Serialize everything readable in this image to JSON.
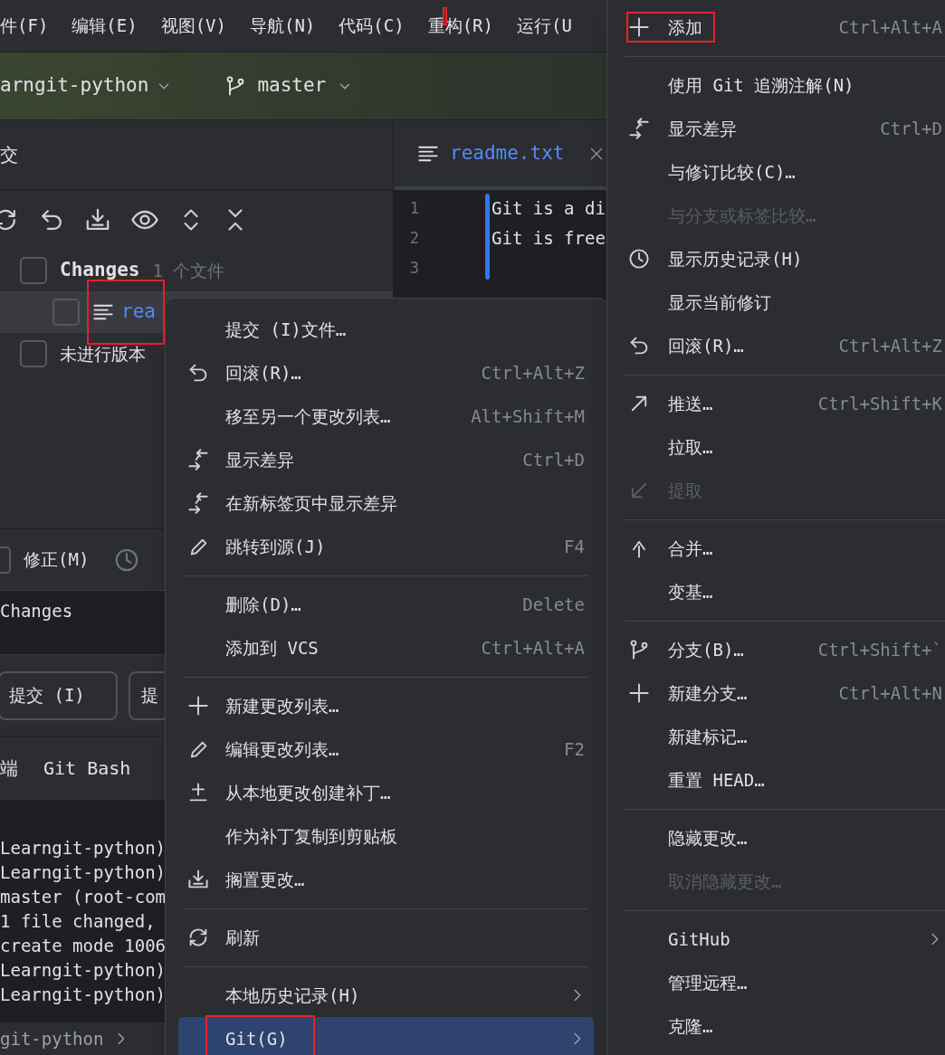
{
  "menu_bar": [
    {
      "label": "件(F)",
      "annotated": false
    },
    {
      "label": "编辑(E)",
      "annotated": false
    },
    {
      "label": "视图(V)",
      "annotated": false
    },
    {
      "label": "导航(N)",
      "annotated": false
    },
    {
      "label": "代码(C)",
      "annotated": false
    },
    {
      "label": "重构(R)",
      "annotated": true
    },
    {
      "label": "运行(U",
      "annotated": false
    }
  ],
  "toolbar": {
    "project": "arngit-python",
    "branch": "master"
  },
  "commit_panel": {
    "title": "交",
    "changes": {
      "label": "Changes",
      "count": "1 个文件",
      "checked": false
    },
    "files": [
      {
        "name": "rea",
        "checked": false,
        "selected": true,
        "annotated": true
      }
    ],
    "unversioned": {
      "label": "未进行版本",
      "checked": false
    },
    "amend": {
      "label": "修正(M)",
      "checked": false
    },
    "message": "Changes",
    "buttons": [
      "提交 (I)",
      "提"
    ]
  },
  "editor": {
    "tab": "readme.txt",
    "lines": [
      {
        "number": "1",
        "text": "Git is a di"
      },
      {
        "number": "2",
        "text": "Git is free"
      },
      {
        "number": "3"
      }
    ]
  },
  "terminal": {
    "tabs": [
      "端",
      "Git Bash"
    ],
    "lines": [
      "Learngit-python)",
      "Learngit-python)",
      "master (root-com",
      "1 file changed,",
      "create mode 1006",
      "Learngit-python)",
      "Learngit-python)"
    ]
  },
  "breadcrumb": "git-python",
  "context_menu": {
    "groups": [
      [
        {
          "label": "提交 (I)文件…",
          "kind": "plain",
          "selected": false
        },
        {
          "label": "回滚(R)…",
          "kind": "rollback",
          "shortcut": "Ctrl+Alt+Z",
          "selected": false
        },
        {
          "label": "移至另一个更改列表…",
          "kind": "plain",
          "shortcut": "Alt+Shift+M",
          "selected": false
        },
        {
          "label": "显示差异",
          "kind": "diff",
          "shortcut": "Ctrl+D",
          "selected": false
        },
        {
          "label": "在新标签页中显示差异",
          "kind": "diff",
          "selected": false
        },
        {
          "label": "跳转到源(J)",
          "kind": "edit",
          "shortcut": "F4",
          "selected": false
        }
      ],
      [
        {
          "label": "删除(D)…",
          "kind": "plain",
          "shortcut": "Delete",
          "selected": false
        },
        {
          "label": "添加到 VCS",
          "kind": "plain",
          "shortcut": "Ctrl+Alt+A",
          "selected": false
        }
      ],
      [
        {
          "label": "新建更改列表…",
          "kind": "add",
          "selected": false
        },
        {
          "label": "编辑更改列表…",
          "kind": "edit",
          "shortcut": "F2",
          "selected": false
        },
        {
          "label": "从本地更改创建补丁…",
          "kind": "patch",
          "selected": false
        },
        {
          "label": "作为补丁复制到剪贴板",
          "kind": "plain",
          "selected": false
        },
        {
          "label": "搁置更改…",
          "kind": "shelve",
          "selected": false
        }
      ],
      [
        {
          "label": "刷新",
          "kind": "refresh",
          "selected": false
        }
      ],
      [
        {
          "label": "本地历史记录(H)",
          "kind": "plain",
          "submenu": true,
          "selected": false
        },
        {
          "label": "Git(G)",
          "kind": "plain",
          "submenu": true,
          "selected": true,
          "annotated": true
        }
      ]
    ]
  },
  "git_menu": {
    "groups": [
      [
        {
          "label": "添加",
          "kind": "add",
          "shortcut": "Ctrl+Alt+A",
          "disabled": false,
          "annotated": true
        }
      ],
      [
        {
          "label": "使用 Git 追溯注解(N)",
          "kind": "plain",
          "disabled": false
        },
        {
          "label": "显示差异",
          "kind": "diff",
          "shortcut": "Ctrl+D",
          "disabled": false
        },
        {
          "label": "与修订比较(C)…",
          "kind": "plain",
          "disabled": false
        },
        {
          "label": "与分支或标签比较…",
          "kind": "plain",
          "disabled": true
        },
        {
          "label": "显示历史记录(H)",
          "kind": "history",
          "disabled": false
        },
        {
          "label": "显示当前修订",
          "kind": "plain",
          "disabled": false
        },
        {
          "label": "回滚(R)…",
          "kind": "rollback",
          "shortcut": "Ctrl+Alt+Z",
          "disabled": false
        }
      ],
      [
        {
          "label": "推送…",
          "kind": "push",
          "shortcut": "Ctrl+Shift+K",
          "disabled": false
        },
        {
          "label": "拉取…",
          "kind": "plain",
          "disabled": false
        },
        {
          "label": "提取",
          "kind": "fetch",
          "disabled": true
        }
      ],
      [
        {
          "label": "合并…",
          "kind": "merge",
          "disabled": false
        },
        {
          "label": "变基…",
          "kind": "plain",
          "disabled": false
        }
      ],
      [
        {
          "label": "分支(B)…",
          "kind": "branch",
          "shortcut": "Ctrl+Shift+`",
          "disabled": false
        },
        {
          "label": "新建分支…",
          "kind": "add",
          "shortcut": "Ctrl+Alt+N",
          "disabled": false
        },
        {
          "label": "新建标记…",
          "kind": "plain",
          "disabled": false
        },
        {
          "label": "重置 HEAD…",
          "kind": "plain",
          "disabled": false
        }
      ],
      [
        {
          "label": "隐藏更改…",
          "kind": "plain",
          "disabled": false
        },
        {
          "label": "取消隐藏更改…",
          "kind": "plain",
          "disabled": true
        }
      ],
      [
        {
          "label": "GitHub",
          "kind": "plain",
          "submenu": true,
          "disabled": false
        },
        {
          "label": "管理远程…",
          "kind": "plain",
          "disabled": false
        },
        {
          "label": "克隆…",
          "kind": "plain",
          "disabled": false
        }
      ]
    ]
  }
}
